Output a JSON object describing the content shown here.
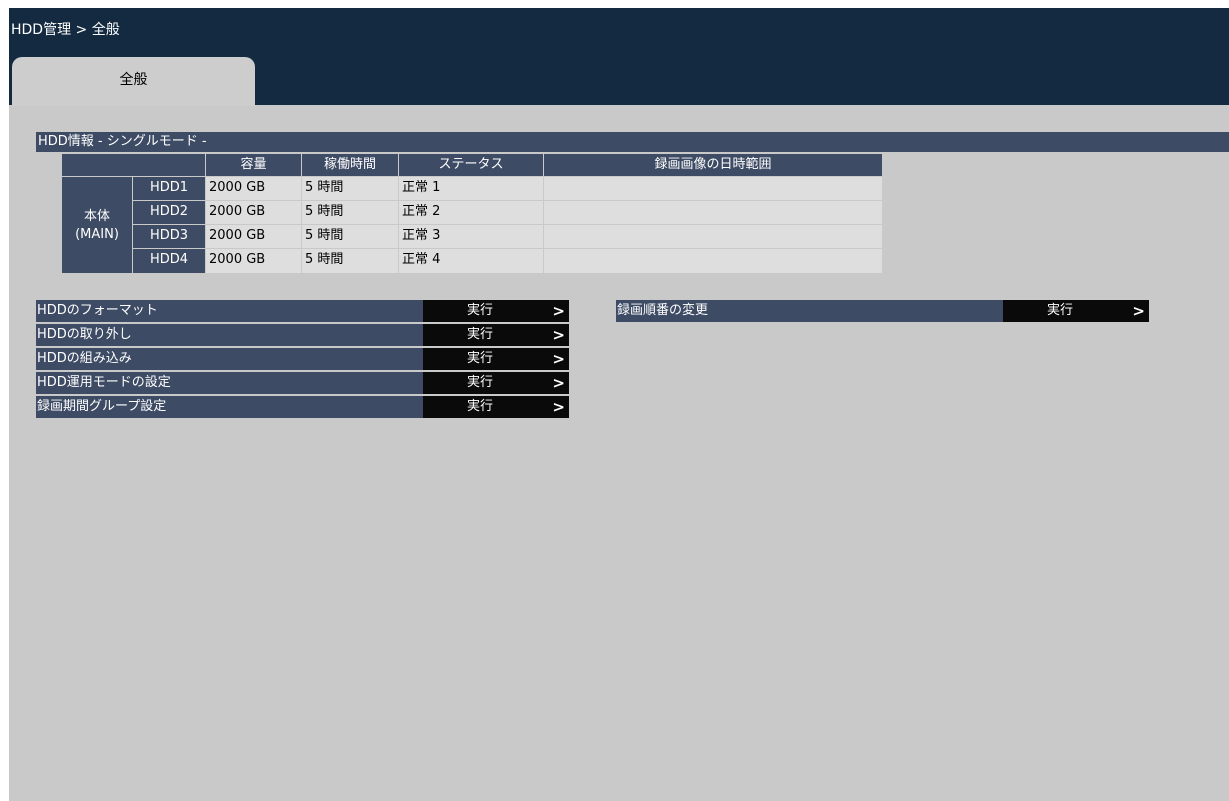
{
  "header": {
    "breadcrumb": "HDD管理 > 全般"
  },
  "tabs": [
    {
      "label": "全般",
      "active": true
    }
  ],
  "hdd_info": {
    "section_title": "HDD情報 - シングルモード -",
    "columns": [
      "容量",
      "稼働時間",
      "ステータス",
      "録画画像の日時範囲"
    ],
    "group_label_line1": "本体",
    "group_label_line2": "(MAIN)",
    "rows": [
      {
        "name": "HDD1",
        "capacity": "2000 GB",
        "uptime": "5 時間",
        "status": "正常 1",
        "range": ""
      },
      {
        "name": "HDD2",
        "capacity": "2000 GB",
        "uptime": "5 時間",
        "status": "正常 2",
        "range": ""
      },
      {
        "name": "HDD3",
        "capacity": "2000 GB",
        "uptime": "5 時間",
        "status": "正常 3",
        "range": ""
      },
      {
        "name": "HDD4",
        "capacity": "2000 GB",
        "uptime": "5 時間",
        "status": "正常 4",
        "range": ""
      }
    ]
  },
  "actions_left": [
    {
      "label": "HDDのフォーマット",
      "button": "実行"
    },
    {
      "label": "HDDの取り外し",
      "button": "実行"
    },
    {
      "label": "HDDの組み込み",
      "button": "実行"
    },
    {
      "label": "HDD運用モードの設定",
      "button": "実行"
    },
    {
      "label": "録画期間グループ設定",
      "button": "実行"
    }
  ],
  "actions_right": [
    {
      "label": "録画順番の変更",
      "button": "実行"
    }
  ],
  "icons": {
    "arrow": "chevron-right-icon",
    "arrow_glyph": ">"
  }
}
